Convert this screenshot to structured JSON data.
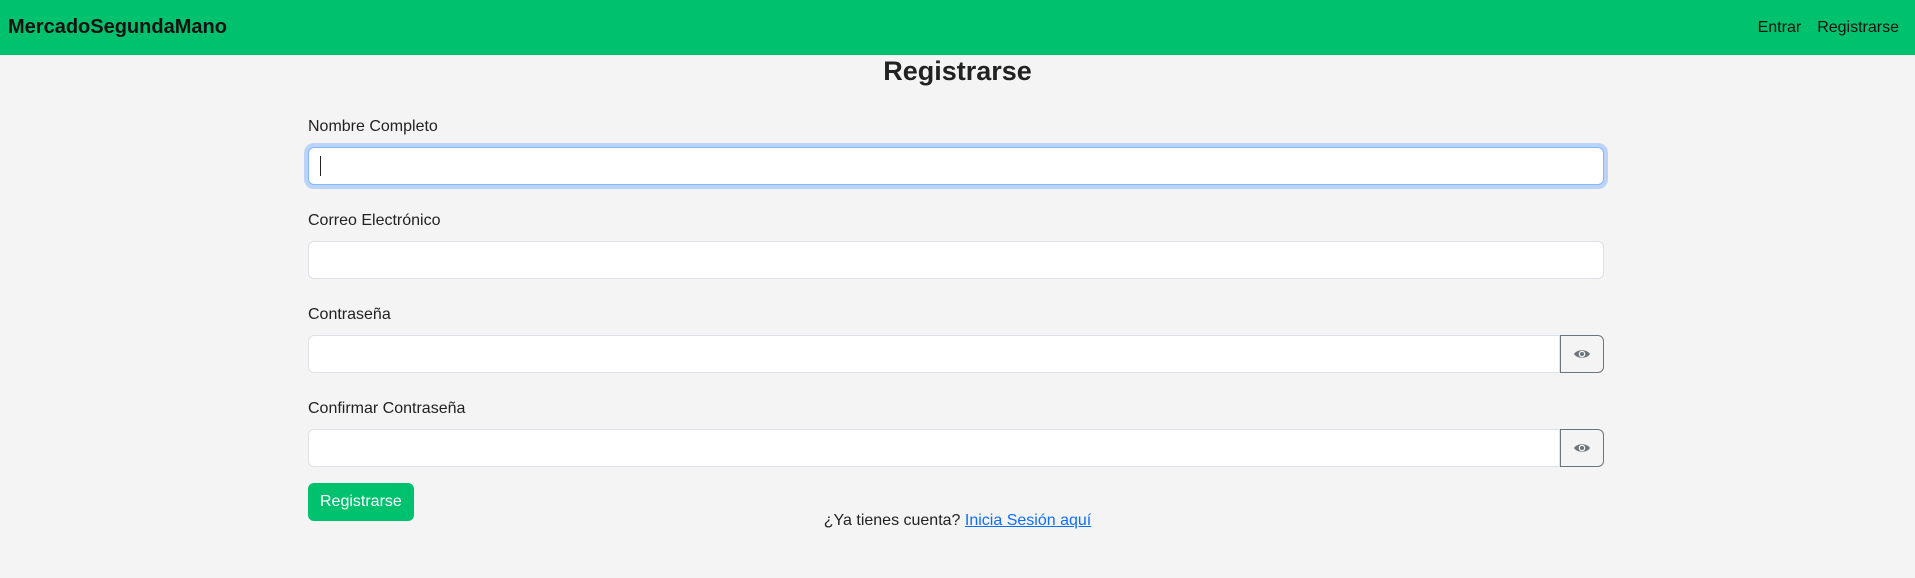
{
  "navbar": {
    "brand": "MercadoSegundaMano",
    "links": [
      "Entrar",
      "Registrarse"
    ]
  },
  "page": {
    "title": "Registrarse"
  },
  "form": {
    "fields": [
      {
        "label": "Nombre Completo",
        "value": ""
      },
      {
        "label": "Correo Electrónico",
        "value": ""
      },
      {
        "label": "Contraseña",
        "value": ""
      },
      {
        "label": "Confirmar Contraseña",
        "value": ""
      }
    ],
    "submit_label": "Registrarse"
  },
  "footer": {
    "prompt": "¿Ya tienes cuenta?",
    "link": "Inicia Sesión aquí"
  },
  "icons": {
    "toggle_password": "eye-icon"
  },
  "colors": {
    "brand_green": "#00c16e",
    "link_blue": "#0d6efd",
    "background": "#f4f4f4"
  }
}
